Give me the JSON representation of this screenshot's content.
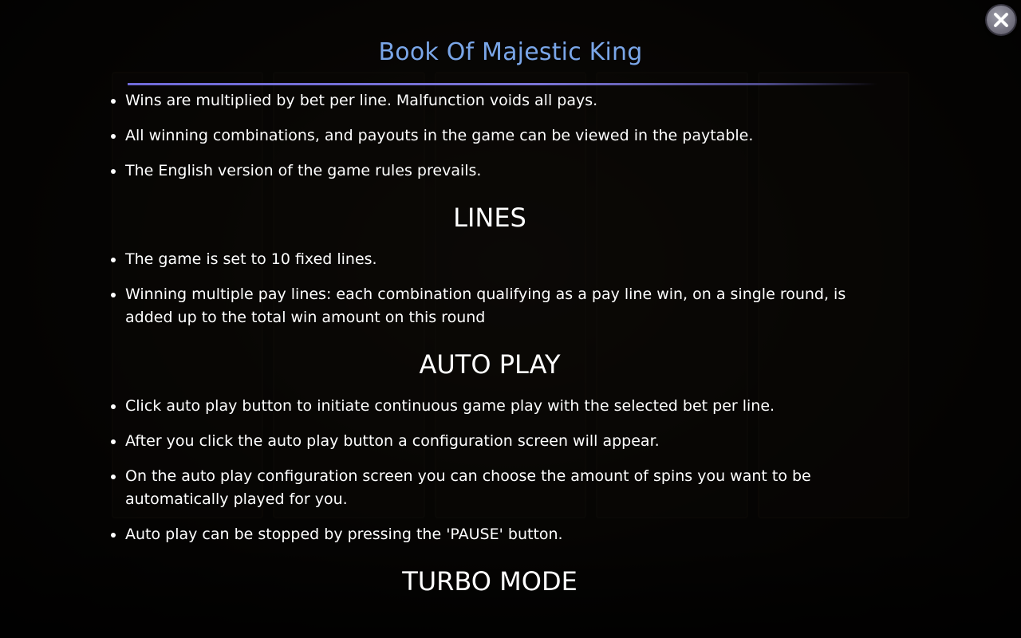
{
  "dialog": {
    "title": "Book Of Majestic King",
    "close_icon": "close-icon"
  },
  "general_rules": [
    "Wins are multiplied by bet per line. Malfunction voids all pays.",
    "All winning combinations, and payouts in the game can be viewed in the paytable.",
    "The English version of the game rules prevails."
  ],
  "sections": {
    "lines": {
      "title": "LINES",
      "items": [
        "The game is set to 10 fixed lines.",
        "Winning multiple pay lines: each combination qualifying as a pay line win, on a single round, is added up to the total win amount on this round"
      ]
    },
    "auto_play": {
      "title": "AUTO PLAY",
      "items": [
        "Click auto play button to initiate continuous game play with the selected bet per line.",
        "After you click the auto play button a configuration screen will appear.",
        "On the auto play configuration screen you can choose the amount of spins you want to be automatically played for you.",
        "Auto play can be stopped by pressing the 'PAUSE' button."
      ]
    },
    "turbo_mode": {
      "title": "TURBO MODE"
    }
  },
  "colors": {
    "title": "#7aa6e8",
    "rule": "#6f6ad8",
    "text": "#ffffff"
  }
}
